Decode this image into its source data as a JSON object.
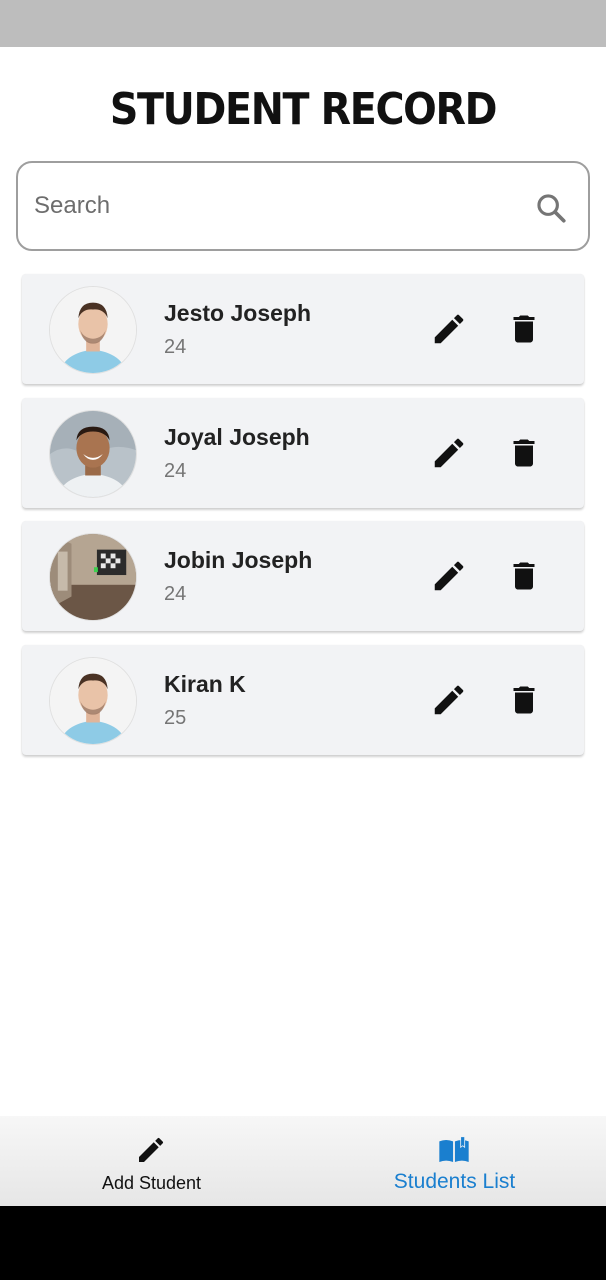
{
  "header": {
    "title": "STUDENT RECORD"
  },
  "search": {
    "placeholder": "Search",
    "icon": "search-icon"
  },
  "students": [
    {
      "name": "Jesto Joseph",
      "age": "24",
      "avatar": "man-blue-shirt-photo"
    },
    {
      "name": "Joyal Joseph",
      "age": "24",
      "avatar": "smiling-man-photo"
    },
    {
      "name": "Jobin Joseph",
      "age": "24",
      "avatar": "room-photo"
    },
    {
      "name": "Kiran K",
      "age": "25",
      "avatar": "man-blue-shirt-photo"
    }
  ],
  "actions": {
    "edit_icon": "pencil-icon",
    "delete_icon": "trash-icon"
  },
  "bottom_nav": {
    "items": [
      {
        "label": "Add Student",
        "icon": "pencil-icon",
        "active": false
      },
      {
        "label": "Students List",
        "icon": "book-icon",
        "active": true
      }
    ]
  },
  "colors": {
    "accent": "#1a7fcf",
    "card_bg": "#f2f3f5",
    "status_bar": "#bdbdbd"
  }
}
